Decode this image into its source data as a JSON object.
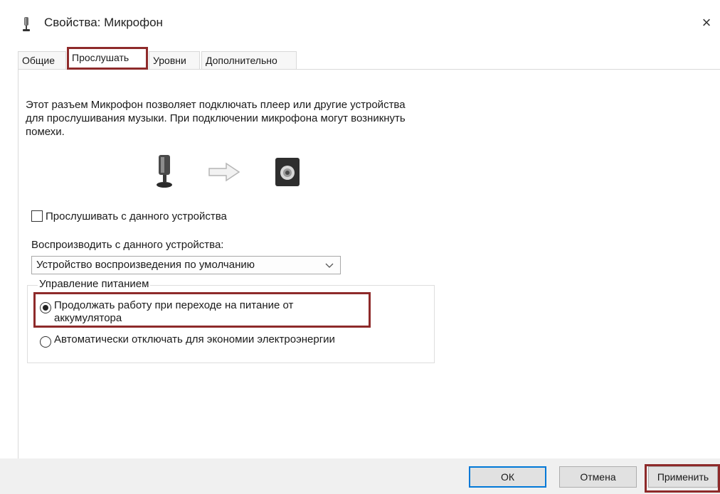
{
  "window": {
    "title": "Свойства: Микрофон",
    "close_icon": "×",
    "title_icon": "microphone-icon"
  },
  "tabs": [
    {
      "label": "Общие",
      "active": false
    },
    {
      "label": "Прослушать",
      "active": true
    },
    {
      "label": "Уровни",
      "active": false
    },
    {
      "label": "Дополнительно",
      "active": false
    }
  ],
  "listen": {
    "description": "Этот разъем Микрофон позволяет подключать плеер или другие устройства для прослушивания музыки. При подключении микрофона могут возникнуть помехи.",
    "icons": [
      "microphone-icon",
      "arrow-right-icon",
      "speaker-icon"
    ],
    "listen_checkbox": {
      "label": "Прослушивать с данного устройства",
      "checked": false
    },
    "playback_label": "Воспроизводить с данного устройства:",
    "playback_dropdown": {
      "value": "Устройство воспроизведения по умолчанию"
    }
  },
  "power": {
    "legend": "Управление питанием",
    "options": [
      {
        "label": "Продолжать работу при переходе на питание от аккумулятора",
        "checked": true
      },
      {
        "label": "Автоматически отключать для экономии электроэнергии",
        "checked": false
      }
    ]
  },
  "buttons": {
    "ok": "ОК",
    "cancel": "Отмена",
    "apply": "Применить"
  },
  "highlight_color": "#8e2a2a",
  "accent_color": "#0078d7"
}
